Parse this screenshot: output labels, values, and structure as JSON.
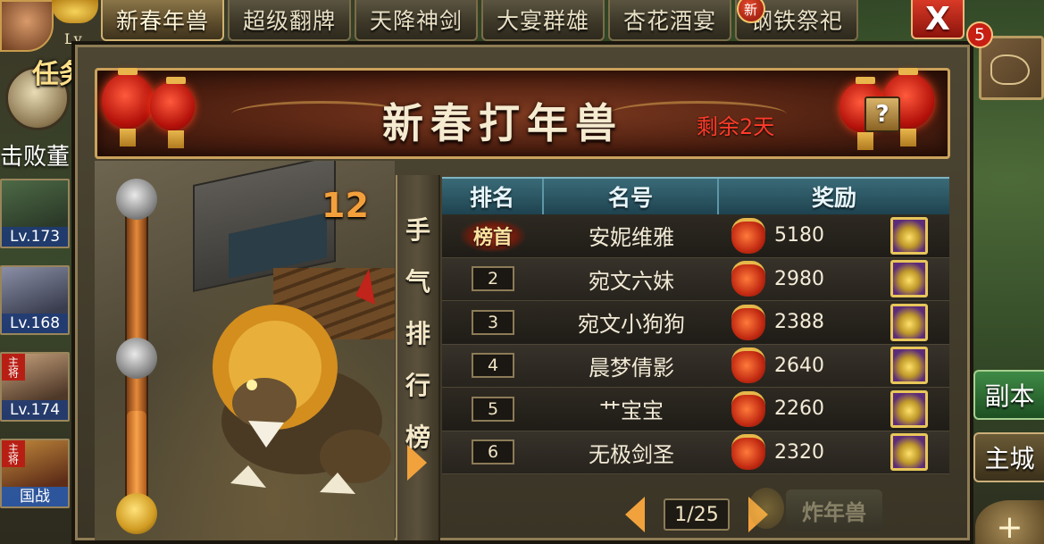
{
  "tabs": [
    {
      "label": "新春年兽",
      "active": true
    },
    {
      "label": "超级翻牌",
      "active": false
    },
    {
      "label": "天降神剑",
      "active": false
    },
    {
      "label": "大宴群雄",
      "active": false
    },
    {
      "label": "杏花酒宴",
      "active": false
    },
    {
      "label": "钢铁祭祀",
      "active": false,
      "badge": "新"
    }
  ],
  "top_left": {
    "lv_label": "Lv",
    "quest_label": "任务",
    "defeat_text": "击败董"
  },
  "heroes": [
    {
      "lv": "Lv.173",
      "main": false
    },
    {
      "lv": "Lv.168",
      "main": false
    },
    {
      "lv": "Lv.174",
      "main": true,
      "main_label": "主将"
    },
    {
      "lv": "国战",
      "main": true,
      "main_label": "主将"
    }
  ],
  "notify_count": "5",
  "close_label": "X",
  "side_buttons": {
    "copy": "副本",
    "city": "主城",
    "plus": "+"
  },
  "event": {
    "title": "新春打年兽",
    "days_left": "剩余2天",
    "help_label": "?",
    "level": "12",
    "progress": 0.35
  },
  "ranking": {
    "side_title": [
      "手",
      "气",
      "排",
      "行",
      "榜"
    ],
    "headers": [
      "排名",
      "名号",
      "奖励"
    ],
    "rows": [
      {
        "rank": "榜首",
        "name": "安妮维雅",
        "reward": "5180"
      },
      {
        "rank": "2",
        "name": "宛文六妹",
        "reward": "2980"
      },
      {
        "rank": "3",
        "name": "宛文小狗狗",
        "reward": "2388"
      },
      {
        "rank": "4",
        "name": "晨梦倩影",
        "reward": "2640"
      },
      {
        "rank": "5",
        "name": "艹宝宝",
        "reward": "2260"
      },
      {
        "rank": "6",
        "name": "无极剑圣",
        "reward": "2320"
      }
    ],
    "page": "1/25"
  },
  "fight_button": "炸年兽",
  "colors": {
    "accent": "#f2a23c",
    "header_teal": "#1f4350",
    "days_left_red": "#ff3b2a"
  }
}
